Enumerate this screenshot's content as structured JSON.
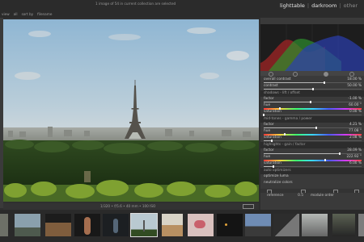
{
  "top": {
    "status": "1 image of 54 in current collection are selected",
    "views": {
      "lighttable": "lighttable",
      "darkroom": "darkroom",
      "other": "other"
    }
  },
  "filter": {
    "view_label": "view",
    "view_value": "all",
    "sort_label": "sort by",
    "sort_value": "filename"
  },
  "bottominfo": {
    "exif": "1/320 • f/5.6 • 40 mm • 100 ISO"
  },
  "panel": {
    "modules": [
      {
        "label": "overall contrast",
        "value": "18.00 %",
        "pct": 0.62
      },
      {
        "label": "contrast",
        "value": "50.00 %",
        "pct": 0.5
      },
      {
        "label": "shadows - lift / offset",
        "section": true
      },
      {
        "label": "factor",
        "value": "-1.00 %",
        "pct": 0.48
      },
      {
        "label": "hue",
        "value": "60.00 °",
        "pct": 0.16,
        "hue": true
      },
      {
        "label": "saturation",
        "value": "0.00 %",
        "pct": 0.0
      },
      {
        "label": "mid-tones - gamma / power",
        "section": true
      },
      {
        "label": "factor",
        "value": "4.21 %",
        "pct": 0.54
      },
      {
        "label": "hue",
        "value": "77.08 °",
        "pct": 0.21,
        "hue": true
      },
      {
        "label": "saturation",
        "value": "2.08 %",
        "pct": 0.08
      },
      {
        "label": "highlights - gain / factor",
        "section": true
      },
      {
        "label": "factor",
        "value": "28.09 %",
        "pct": 0.78
      },
      {
        "label": "hue",
        "value": "222.92 °",
        "pct": 0.62,
        "hue": true
      },
      {
        "label": "saturation",
        "value": "6.00 %",
        "pct": 0.1
      },
      {
        "label": "auto optimizers",
        "section": true
      },
      {
        "label": "optimize luma",
        "value": "",
        "pct": 0
      },
      {
        "label": "neutralize colors",
        "value": "",
        "pct": 0
      }
    ],
    "reference_label": "reference",
    "reference_value": "0.5",
    "module_order_label": "module order"
  },
  "colors": {
    "accent": "#e6e6e6"
  }
}
